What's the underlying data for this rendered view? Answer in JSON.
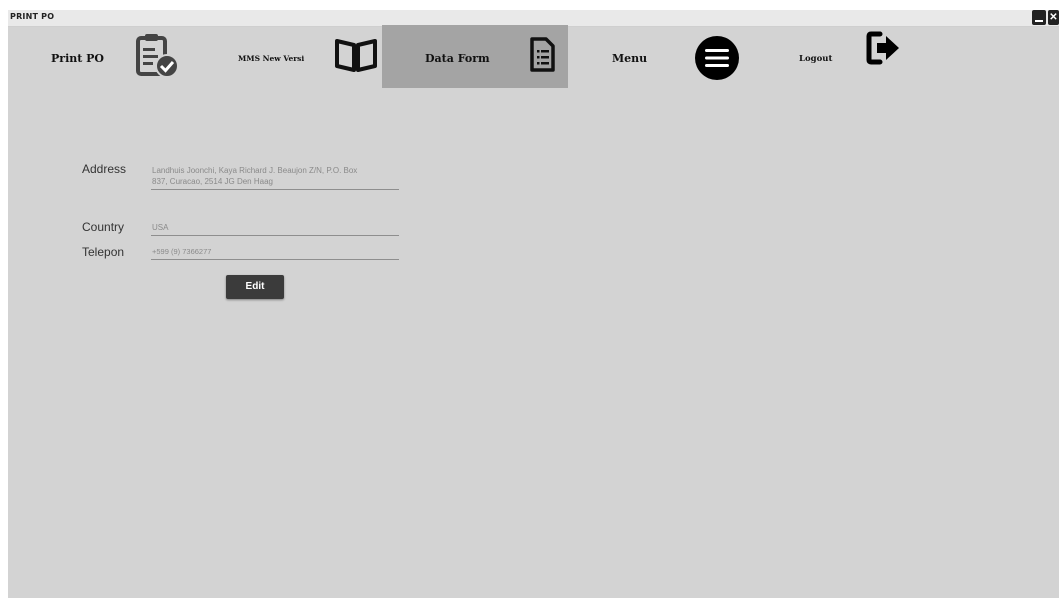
{
  "window": {
    "title": "PRINT PO",
    "close_glyph": "✕"
  },
  "nav": {
    "print_po": {
      "label": "Print PO",
      "icon": "clipboard-check-icon"
    },
    "mms": {
      "label": "MMS New Versi",
      "icon": "open-book-icon"
    },
    "data_form": {
      "label": "Data Form",
      "icon": "document-list-icon"
    },
    "menu": {
      "label": "Menu",
      "icon": "hamburger-menu-icon"
    },
    "logout": {
      "label": "Logout",
      "icon": "logout-icon"
    }
  },
  "form": {
    "address": {
      "label": "Address",
      "value_line1": "Landhuis Joonchi, Kaya Richard J. Beaujon Z/N, P.O. Box",
      "value_line2": "837, Curacao, 2514 JG Den Haag"
    },
    "country": {
      "label": "Country",
      "value": "USA"
    },
    "telepon": {
      "label": "Telepon",
      "value": "+599 (9) 7366277"
    },
    "edit_label": "Edit"
  },
  "colors": {
    "background": "#d3d3d3",
    "active_tab": "#a4a4a4",
    "button": "#3b3b3b"
  }
}
